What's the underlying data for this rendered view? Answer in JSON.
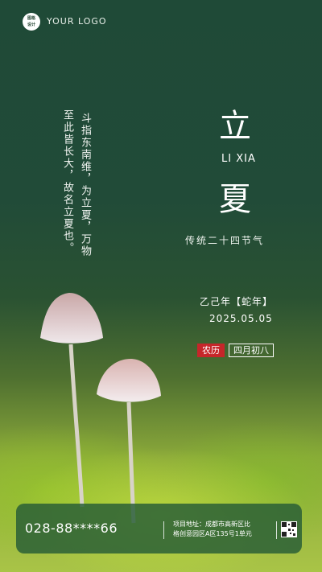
{
  "logo": {
    "badge_text": "图格设计",
    "text": "YOUR LOGO"
  },
  "title": {
    "char1": "立",
    "char2": "夏",
    "pinyin": "LI XIA",
    "subtitle": "传统二十四节气"
  },
  "verse": {
    "col1": "斗指东南维，为立夏，万物",
    "col2": "至此皆长大，故名立夏也。"
  },
  "date_info": {
    "year": "乙己年【蛇年】",
    "date": "2025.05.05",
    "lunar_tag": "农历",
    "lunar_day": "四月初八"
  },
  "footer": {
    "phone": "028-88****66",
    "address_line1": "项目地址：成都市高新区比",
    "address_line2": "格创意园区A区135号1单元"
  },
  "icons": {
    "qr": "qr-code-icon"
  },
  "colors": {
    "accent_red": "#c6262a",
    "footer_bg": "#265c36"
  }
}
